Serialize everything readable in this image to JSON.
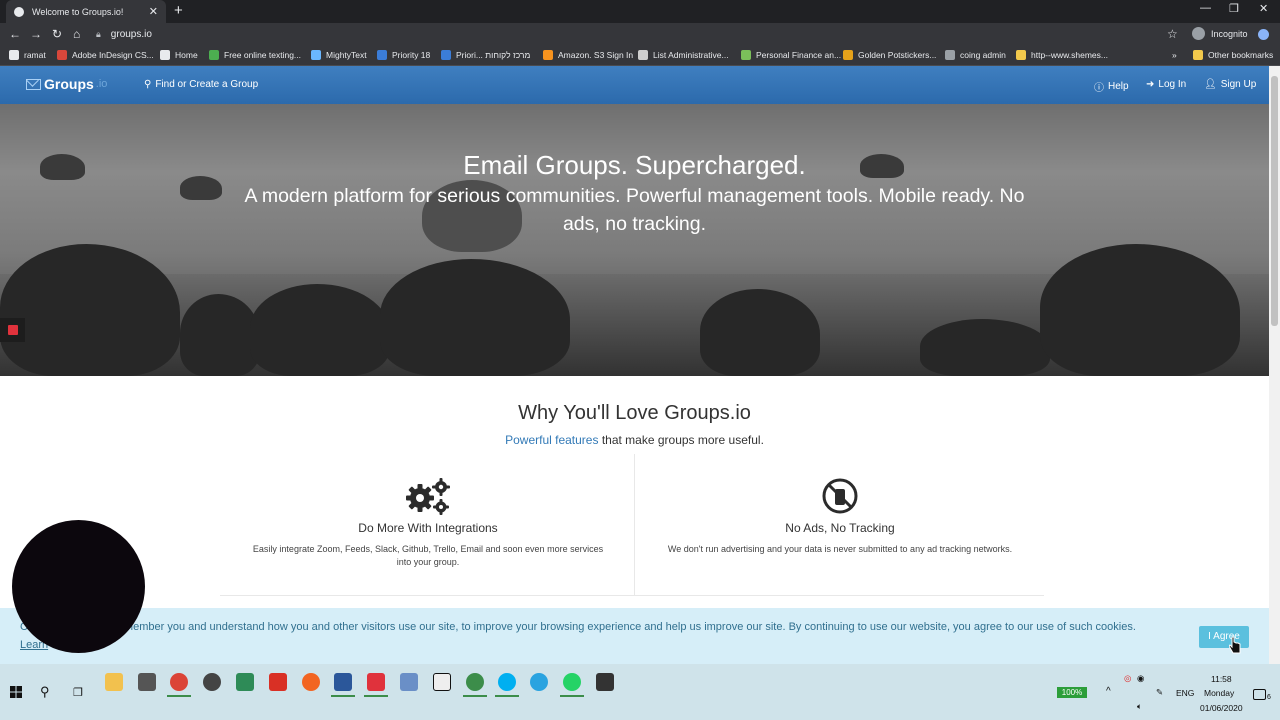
{
  "browser": {
    "tab_title": "Welcome to Groups.io!",
    "url": "groups.io",
    "incognito_label": "Incognito",
    "bookmarks": [
      {
        "label": "ramat",
        "color": "#e8eaed"
      },
      {
        "label": "Adobe InDesign CS...",
        "color": "#d9473b"
      },
      {
        "label": "Home",
        "color": "#e8eaed"
      },
      {
        "label": "Free online texting...",
        "color": "#4caf50"
      },
      {
        "label": "MightyText",
        "color": "#6ab7ff"
      },
      {
        "label": "Priority 18",
        "color": "#3b7dd8"
      },
      {
        "label": "Priori... מרכז לקוחות",
        "color": "#3b7dd8"
      },
      {
        "label": "Amazon. S3 Sign In",
        "color": "#f7931e"
      },
      {
        "label": "List Administrative...",
        "color": "#cfcfcf"
      },
      {
        "label": "Personal Finance an...",
        "color": "#7bbf5a"
      },
      {
        "label": "Golden Potstickers...",
        "color": "#e6a21a"
      },
      {
        "label": "coing admin",
        "color": "#9aa0a6"
      },
      {
        "label": "http--www.shemes...",
        "color": "#f2c94c"
      }
    ],
    "other_bookmarks": "Other bookmarks"
  },
  "site": {
    "brand": "Groups",
    "brand_suffix": ".io",
    "find_group": "Find or Create a Group",
    "help": "Help",
    "login": "Log In",
    "signup": "Sign Up"
  },
  "hero": {
    "title": "Email Groups. Supercharged.",
    "subtitle": "A modern platform for serious communities. Powerful management tools. Mobile ready. No ads, no tracking."
  },
  "why": {
    "title": "Why You'll Love Groups.io",
    "subtitle_link": "Powerful features",
    "subtitle_rest": " that make groups more useful."
  },
  "features": [
    {
      "title": "Do More With Integrations",
      "desc": "Easily integrate Zoom, Feeds, Slack, Github, Trello, Email and soon even more services into your group.",
      "icon": "gears-icon"
    },
    {
      "title": "No Ads, No Tracking",
      "desc": "We don't run advertising and your data is never submitted to any ad tracking networks.",
      "icon": "no-tracking-icon"
    }
  ],
  "cookie": {
    "text": "C... so that we can remember you and understand how you and other visitors use our site, to improve your browsing experience and help us improve our site. By continuing to use our website, you agree to our use of such cookies.",
    "learn": "Learn",
    "agree": "I Agree"
  },
  "taskbar": {
    "apps": [
      {
        "name": "file-explorer",
        "color": "#f2c14e"
      },
      {
        "name": "calculator",
        "color": "#555555"
      },
      {
        "name": "chrome",
        "color": "#db4437"
      },
      {
        "name": "photos",
        "color": "#444444"
      },
      {
        "name": "excel-like",
        "color": "#2e8b57"
      },
      {
        "name": "acrobat",
        "color": "#d93025"
      },
      {
        "name": "app-orange",
        "color": "#f26522"
      },
      {
        "name": "word",
        "color": "#2b579a"
      },
      {
        "name": "app-red",
        "color": "#e0323c"
      },
      {
        "name": "app-network",
        "color": "#6a8fc7"
      },
      {
        "name": "app-window",
        "color": "#eeeeee"
      },
      {
        "name": "app-chat",
        "color": "#3c8d4a"
      },
      {
        "name": "skype",
        "color": "#00aff0"
      },
      {
        "name": "telegram",
        "color": "#2aa3e0"
      },
      {
        "name": "whatsapp",
        "color": "#25d366"
      },
      {
        "name": "sticky",
        "color": "#333333"
      }
    ],
    "battery": "100%",
    "lang": "ENG",
    "time": "11:58",
    "day": "Monday",
    "date": "01/06/2020",
    "notification_count": "6"
  }
}
